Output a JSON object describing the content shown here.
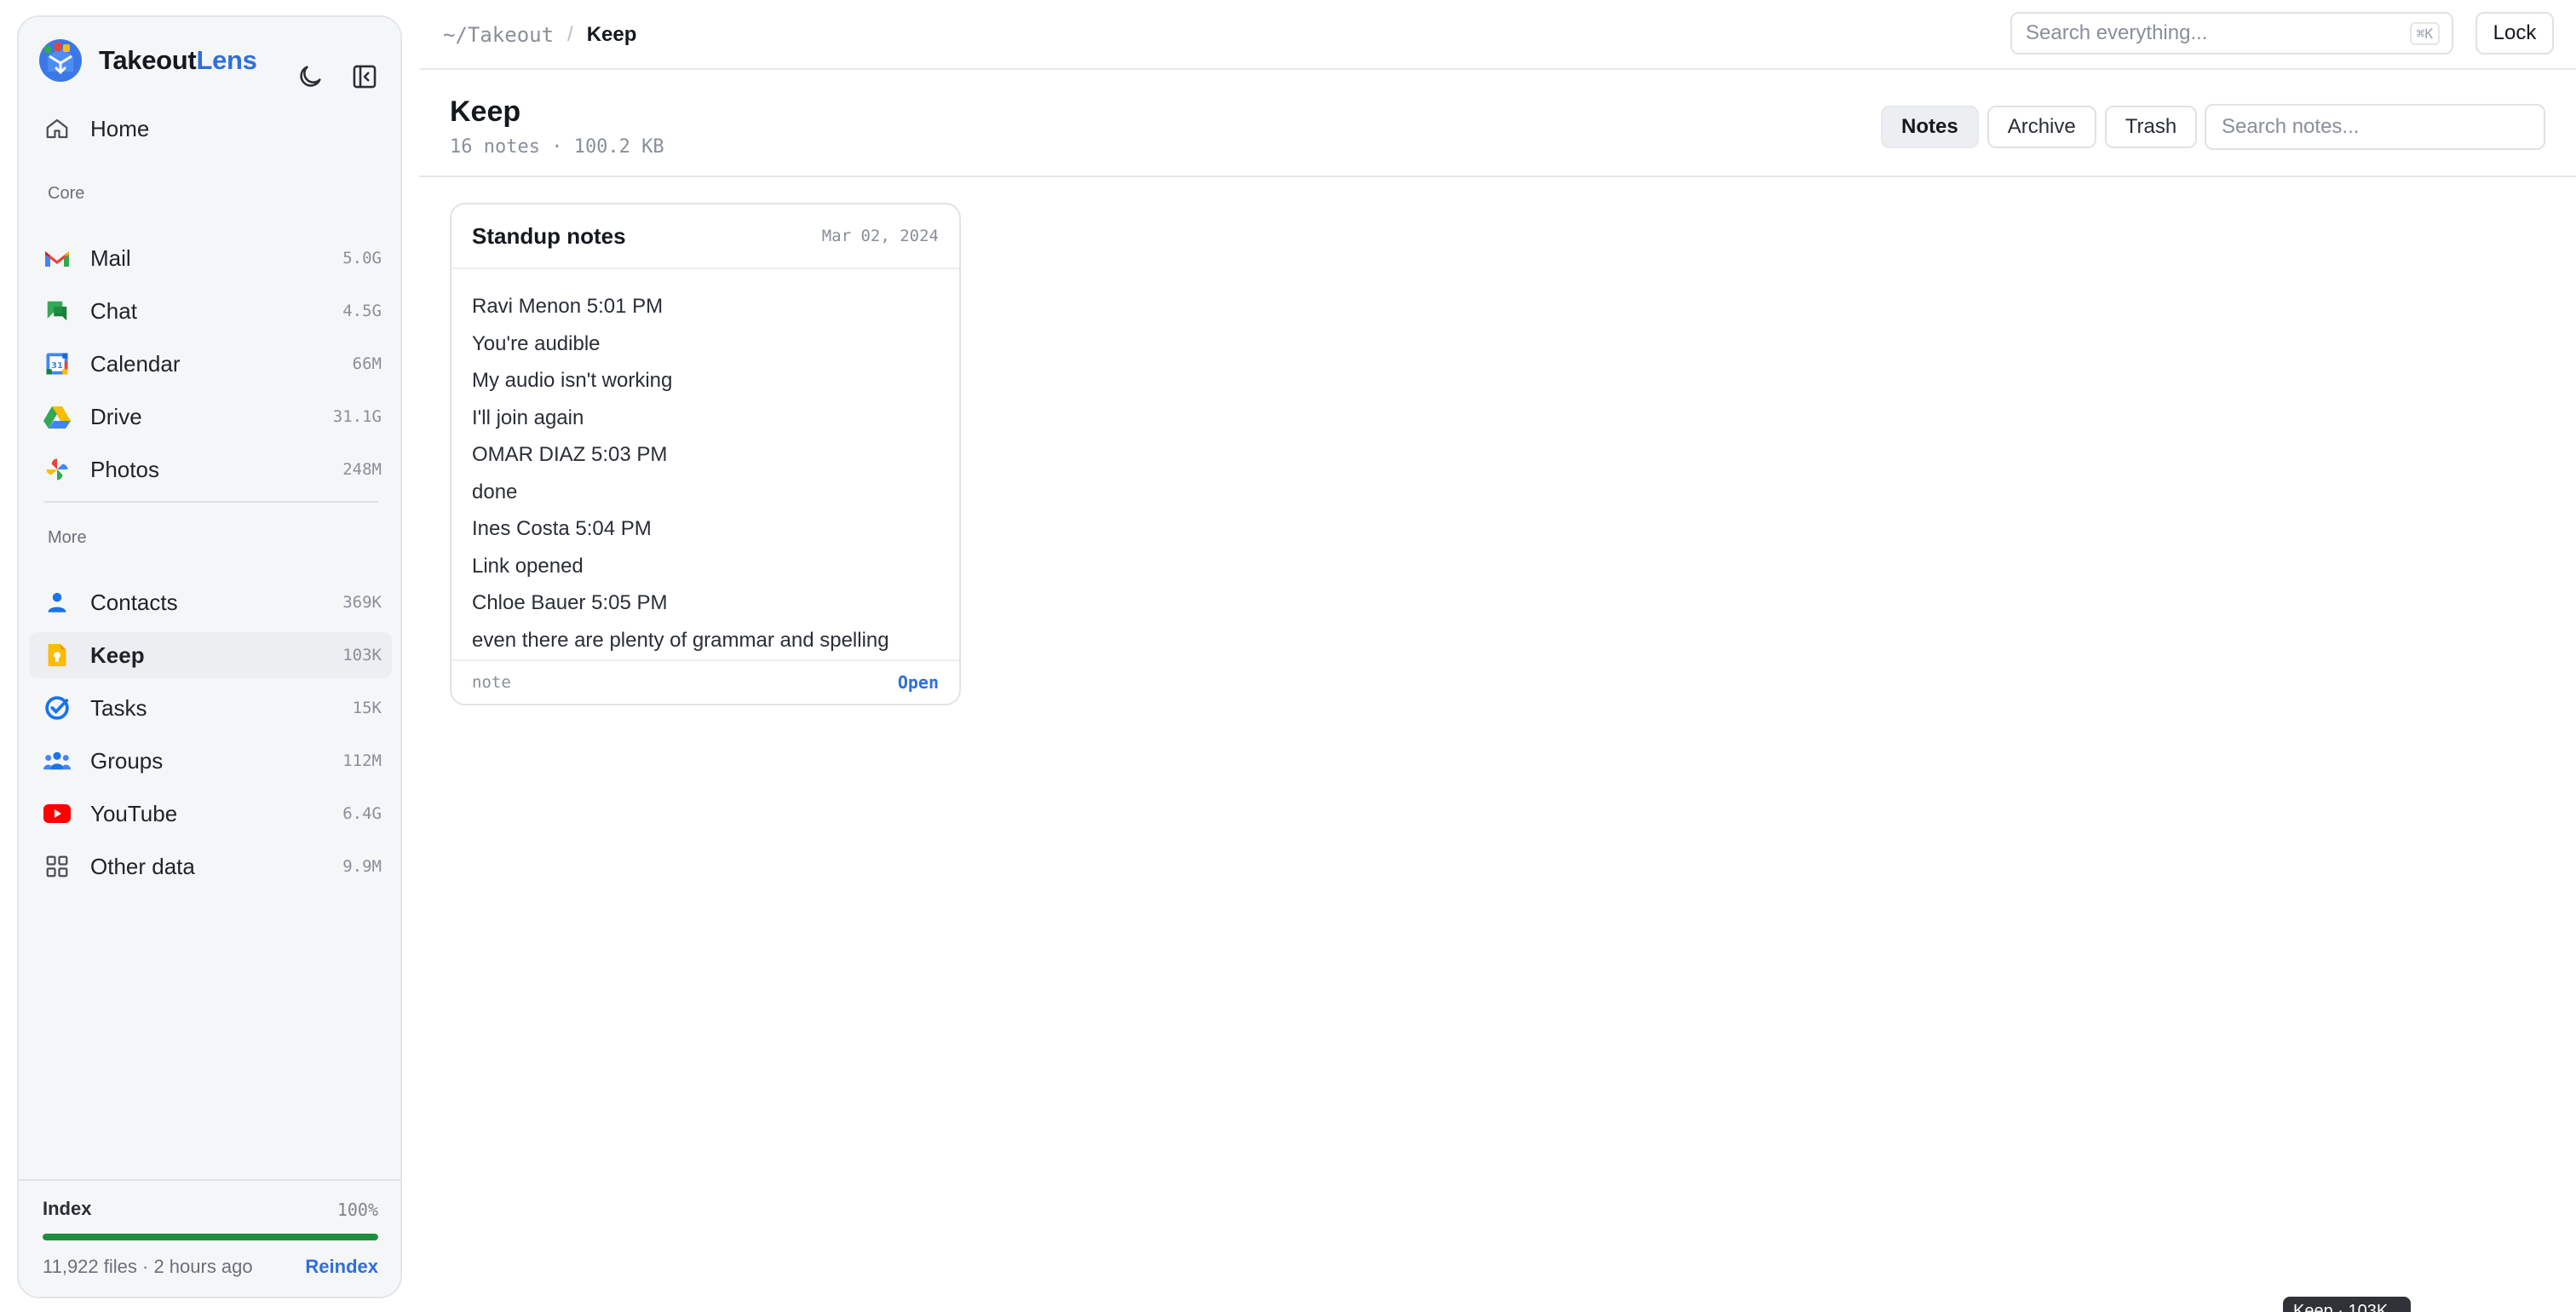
{
  "app": {
    "name_main": "Takeout",
    "name_accent": "Lens",
    "accent_color": "#2f6fd8"
  },
  "sidebar": {
    "home": {
      "label": "Home",
      "icon": "home-icon"
    },
    "core_label": "Core",
    "core": [
      {
        "label": "Mail",
        "count": "5.0G",
        "icon": "gmail-icon"
      },
      {
        "label": "Chat",
        "count": "4.5G",
        "icon": "chat-icon"
      },
      {
        "label": "Calendar",
        "count": "66M",
        "icon": "calendar-icon"
      },
      {
        "label": "Drive",
        "count": "31.1G",
        "icon": "drive-icon"
      },
      {
        "label": "Photos",
        "count": "248M",
        "icon": "photos-icon"
      }
    ],
    "more_label": "More",
    "more": [
      {
        "label": "Contacts",
        "count": "369K",
        "icon": "contacts-icon"
      },
      {
        "label": "Keep",
        "count": "103K",
        "icon": "keep-icon",
        "active": true
      },
      {
        "label": "Tasks",
        "count": "15K",
        "icon": "tasks-icon"
      },
      {
        "label": "Groups",
        "count": "112M",
        "icon": "groups-icon"
      },
      {
        "label": "YouTube",
        "count": "6.4G",
        "icon": "youtube-icon"
      },
      {
        "label": "Other data",
        "count": "9.9M",
        "icon": "grid-icon"
      }
    ],
    "index": {
      "title": "Index",
      "percent": "100%",
      "progress": 1.0,
      "meta": "11,922 files · 2 hours ago",
      "reindex_label": "Reindex",
      "progress_color": "#1e8e3e"
    }
  },
  "topbar": {
    "crumb_root": "~/Takeout",
    "crumb_sep": "/",
    "crumb_current": "Keep",
    "search_placeholder": "Search everything...",
    "search_shortcut": "⌘K",
    "lock_label": "Lock"
  },
  "header": {
    "title": "Keep",
    "subtitle": "16 notes · 100.2 KB",
    "tabs": [
      {
        "label": "Notes",
        "active": true
      },
      {
        "label": "Archive"
      },
      {
        "label": "Trash"
      }
    ],
    "search_placeholder": "Search notes..."
  },
  "notes": [
    {
      "title": "Standup notes",
      "date": "Mar 02, 2024",
      "lines": [
        "Ravi Menon 5:01 PM",
        "You're audible",
        "My audio isn't working",
        "I'll join again",
        "OMAR DIAZ 5:03 PM",
        "done",
        "Ines Costa 5:04 PM",
        "Link opened",
        "Chloe Bauer 5:05 PM",
        "even there are plenty of grammar and spelling"
      ],
      "type": "note",
      "open_label": "Open"
    }
  ],
  "tooltip": "Keep · 103K"
}
